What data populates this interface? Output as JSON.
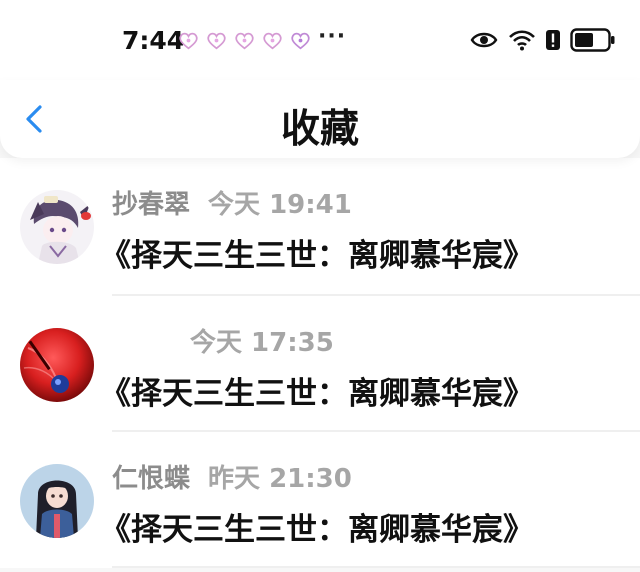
{
  "status_bar": {
    "time": "7:44",
    "notification_icons": [
      "heart-badge-icon",
      "heart-badge-icon",
      "heart-badge-icon",
      "heart-badge-icon",
      "heart-badge-icon"
    ],
    "more": "···",
    "system_icons": [
      "eye-icon",
      "wifi-icon",
      "alert-icon",
      "battery-icon"
    ]
  },
  "header": {
    "back_icon": "chevron-left-icon",
    "title": "收藏"
  },
  "items": [
    {
      "name": "抄春翠",
      "time": "今天 19:41",
      "content": "《择天三生三世：离卿慕华宸》",
      "avatar": "anime-character-avatar"
    },
    {
      "name": "",
      "time": "今天 17:35",
      "content": "《择天三生三世：离卿慕华宸》",
      "avatar": "red-abstract-avatar"
    },
    {
      "name": "仁恨蝶",
      "time": "昨天 21:30",
      "content": "《择天三生三世：离卿慕华宸》",
      "avatar": "anime-girl-avatar"
    }
  ],
  "colors": {
    "accent": "#2a8cf0",
    "text": "#111111",
    "meta": "#9a9a9a"
  }
}
